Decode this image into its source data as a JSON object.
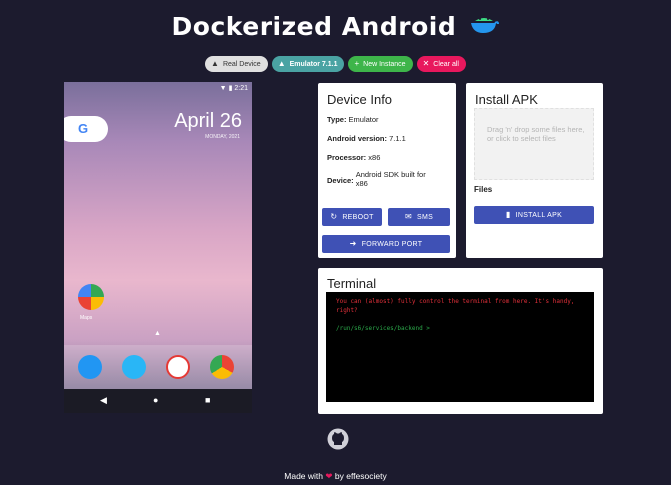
{
  "header": {
    "title": "Dockerized Android",
    "logo_icon": "android-docker-whale-icon"
  },
  "chips": {
    "real_device": "Real Device",
    "emulator": "Emulator 7.1.1",
    "new_instance": "New Instance",
    "clear_all": "Clear all"
  },
  "phone": {
    "status_time": "2:21",
    "date": "April 26",
    "date_sub": "MONDAY, 2021",
    "google_label": "G",
    "maps_label": "Maps"
  },
  "device_info": {
    "title": "Device Info",
    "type_label": "Type:",
    "type_value": "Emulator",
    "android_label": "Android version:",
    "android_value": "7.1.1",
    "processor_label": "Processor:",
    "processor_value": "x86",
    "device_label": "Device:",
    "device_value": "Android SDK built for x86",
    "reboot": "REBOOT",
    "sms": "SMS",
    "forward_port": "FORWARD PORT"
  },
  "install_apk": {
    "title": "Install APK",
    "dropzone_text": "Drag 'n' drop some files here, or click to select files",
    "files_label": "Files",
    "install_button": "INSTALL APK"
  },
  "terminal": {
    "title": "Terminal",
    "message": "You can (almost) fully control the terminal from here. It's handy, right?",
    "prompt": "/run/s6/services/backend >"
  },
  "footer": {
    "made_with": "Made with",
    "by": "by effesociety"
  },
  "colors": {
    "background": "#1c1b2e",
    "primary_button": "#3f51b5",
    "chip_emulator": "#4aa3a3",
    "chip_new": "#3eb54a",
    "chip_clear": "#e8185d"
  }
}
